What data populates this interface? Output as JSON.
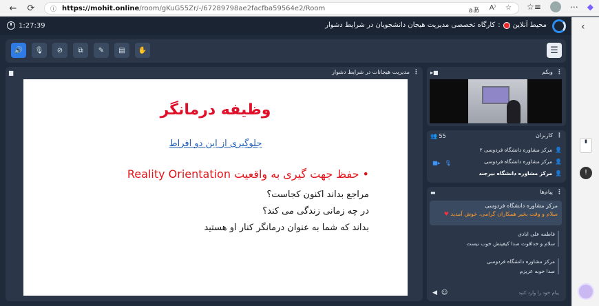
{
  "browser": {
    "back": "←",
    "refresh": "⟳",
    "url_host": "https://mohit.online",
    "url_path": "/room/gKuG55Zr/-/67289798ae2facfba59564e2/Room",
    "address_icons": [
      "aあ",
      "A⁾",
      "☆"
    ],
    "right_icons": [
      "⋯"
    ]
  },
  "app": {
    "elapsed": "1:27:39",
    "brand": "محیط آنلاین",
    "room_title": "کارگاه تخصصی مدیریت هیجان دانشجویان در شرایط دشوار",
    "accent": "#2f7be5"
  },
  "toolbar": {
    "tools": [
      "speaker-icon",
      "mic-off-icon",
      "camera-off-icon",
      "screen-share-icon",
      "brush-icon",
      "file-icon",
      "hand-icon"
    ],
    "tool_glyphs": [
      "🔊",
      "🎙",
      "⊘",
      "⧉",
      "✎",
      "▤",
      "✋"
    ],
    "menu_glyph": "☰"
  },
  "presentation": {
    "header": "مدیریت هیجانات در شرایط دشوار",
    "slide_title": "وظیفه درمانگر",
    "slide_link": "جلوگیری از این دو افراط",
    "bullet": "• حفظ جهت گیری به واقعیت Reality Orientation",
    "lines": [
      "مراجع بداند اکنون کجاست؟",
      "در چه زمانی زندگی می کند؟",
      "بداند که شما به عنوان درمانگر کنار او هستید"
    ]
  },
  "webcam": {
    "header": "وبکم"
  },
  "users": {
    "header": "کاربران",
    "count": "55",
    "list": [
      {
        "name": "مرکز مشاوره دانشگاه فردوسی ۲"
      },
      {
        "name": "مرکز مشاوره دانشگاه فردوسی"
      },
      {
        "name": "مرکز مشاوره دانشگاه بیرجند"
      }
    ]
  },
  "messages": {
    "header": "پیام‌ها",
    "pinned": {
      "sender": "مرکز مشاوره دانشگاه فردوسی",
      "text": "سلام و وقت بخیر همکاران گرامی، خوش آمدید"
    },
    "items": [
      {
        "sender": "فاطمه علی ابادی",
        "text": "سلام و خداقوت صدا کیفیتش خوب نیست"
      },
      {
        "sender": "مرکز مشاوره دانشگاه فردوسی",
        "text": "صدا خوبه عزیزم"
      }
    ],
    "input_placeholder": "پیام خود را وارد کنید"
  }
}
